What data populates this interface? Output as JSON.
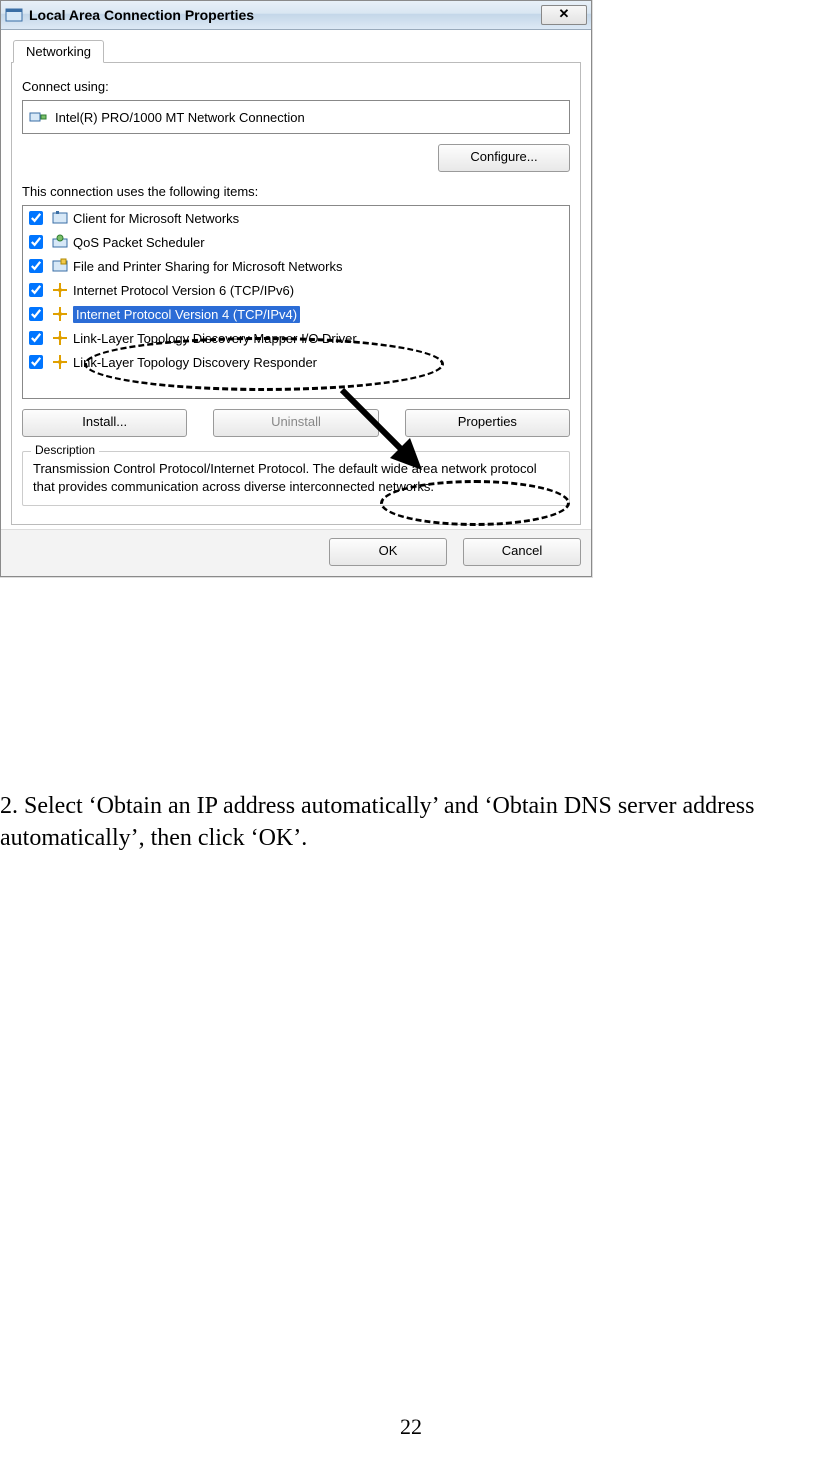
{
  "dialog": {
    "title": "Local Area Connection Properties",
    "close": "✕",
    "tab": "Networking",
    "connect_using_label": "Connect using:",
    "adapter": "Intel(R) PRO/1000 MT Network Connection",
    "configure": "Configure...",
    "items_label": "This connection uses the following items:",
    "items": [
      {
        "label": "Client for Microsoft Networks",
        "checked": true,
        "selected": false
      },
      {
        "label": "QoS Packet Scheduler",
        "checked": true,
        "selected": false
      },
      {
        "label": "File and Printer Sharing for Microsoft Networks",
        "checked": true,
        "selected": false
      },
      {
        "label": "Internet Protocol Version 6 (TCP/IPv6)",
        "checked": true,
        "selected": false
      },
      {
        "label": "Internet Protocol Version 4 (TCP/IPv4)",
        "checked": true,
        "selected": true
      },
      {
        "label": "Link-Layer Topology Discovery Mapper I/O Driver",
        "checked": true,
        "selected": false
      },
      {
        "label": "Link-Layer Topology Discovery Responder",
        "checked": true,
        "selected": false
      }
    ],
    "install": "Install...",
    "uninstall": "Uninstall",
    "properties": "Properties",
    "desc_legend": "Description",
    "desc_text": "Transmission Control Protocol/Internet Protocol. The default wide area network protocol that provides communication across diverse interconnected networks.",
    "ok": "OK",
    "cancel": "Cancel"
  },
  "instruction": "2. Select ‘Obtain an IP address automatically’ and ‘Obtain DNS server address automatically’, then click ‘OK’.",
  "page_number": "22"
}
